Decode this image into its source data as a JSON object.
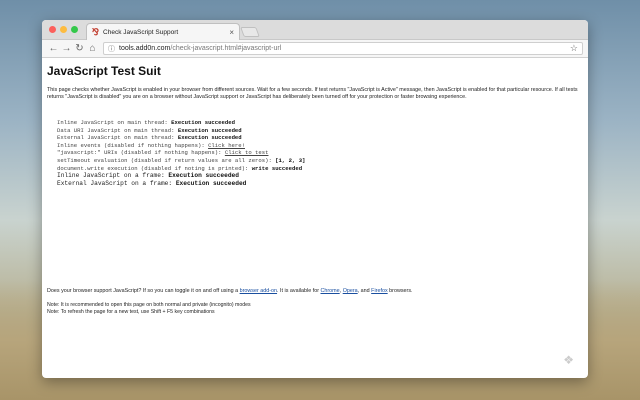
{
  "browser": {
    "tab_title": "Check JavaScript Support",
    "tab_close": "×",
    "url_host": "tools.add0n.com",
    "url_path": "/check-javascript.html#javascript-url"
  },
  "page": {
    "title": "JavaScript Test Suit",
    "intro": "This page checks whether JavaScript is enabled in your browser from different sources. Wait for a few seconds. If test returns \"JavaScript is Active\" message, then JavaScript is enabled for that particular resource. If all tests returns \"JavaScript is disabled\" you are on a browser without JavaScript support or JavaScript has deliberately been turned off for your protection or faster browsing experience.",
    "results": [
      {
        "label": "Inline JavaScript on main thread: ",
        "status": "Execution succeeded",
        "style": "normal"
      },
      {
        "label": "Data URI JavaScript on main thread: ",
        "status": "Execution succeeded",
        "style": "normal"
      },
      {
        "label": "External JavaScript on main thread: ",
        "status": "Execution succeeded",
        "style": "normal"
      },
      {
        "label": "Inline events (disabled if nothing happens): ",
        "link": "Click here!",
        "style": "normal"
      },
      {
        "label": "\"javascript:\" URIs (disabled if nothing happens): ",
        "link": "Click to test",
        "style": "normal"
      },
      {
        "label": "setTimeout evaluation (disabled if return values are all zeros): ",
        "status": "[1, 2, 3]",
        "style": "normal"
      },
      {
        "label": "document.write execution (disabled if noting is printed): ",
        "status": "write succeeded",
        "style": "normal"
      },
      {
        "label": "Inline JavaScript on a frame: ",
        "status": "Execution succeeded",
        "style": "large"
      },
      {
        "label": "External JavaScript on a frame: ",
        "status": "Execution succeeded",
        "style": "large"
      }
    ],
    "question": {
      "p1": "Does your browser support JavaScript? If so you can toggle it on and off using a ",
      "link1": "browser add-on",
      "p2": ". It is available for ",
      "link2": "Chrome",
      "p3": ", ",
      "link3": "Opera",
      "p4": ", and ",
      "link4": "Firefox",
      "p5": " browsers."
    },
    "note1": "Note: It is recommended to open this page on both normal and private (incognito) modes",
    "note2": "Note: To refresh the page for a new test, use Shift + F5 key combinations"
  }
}
